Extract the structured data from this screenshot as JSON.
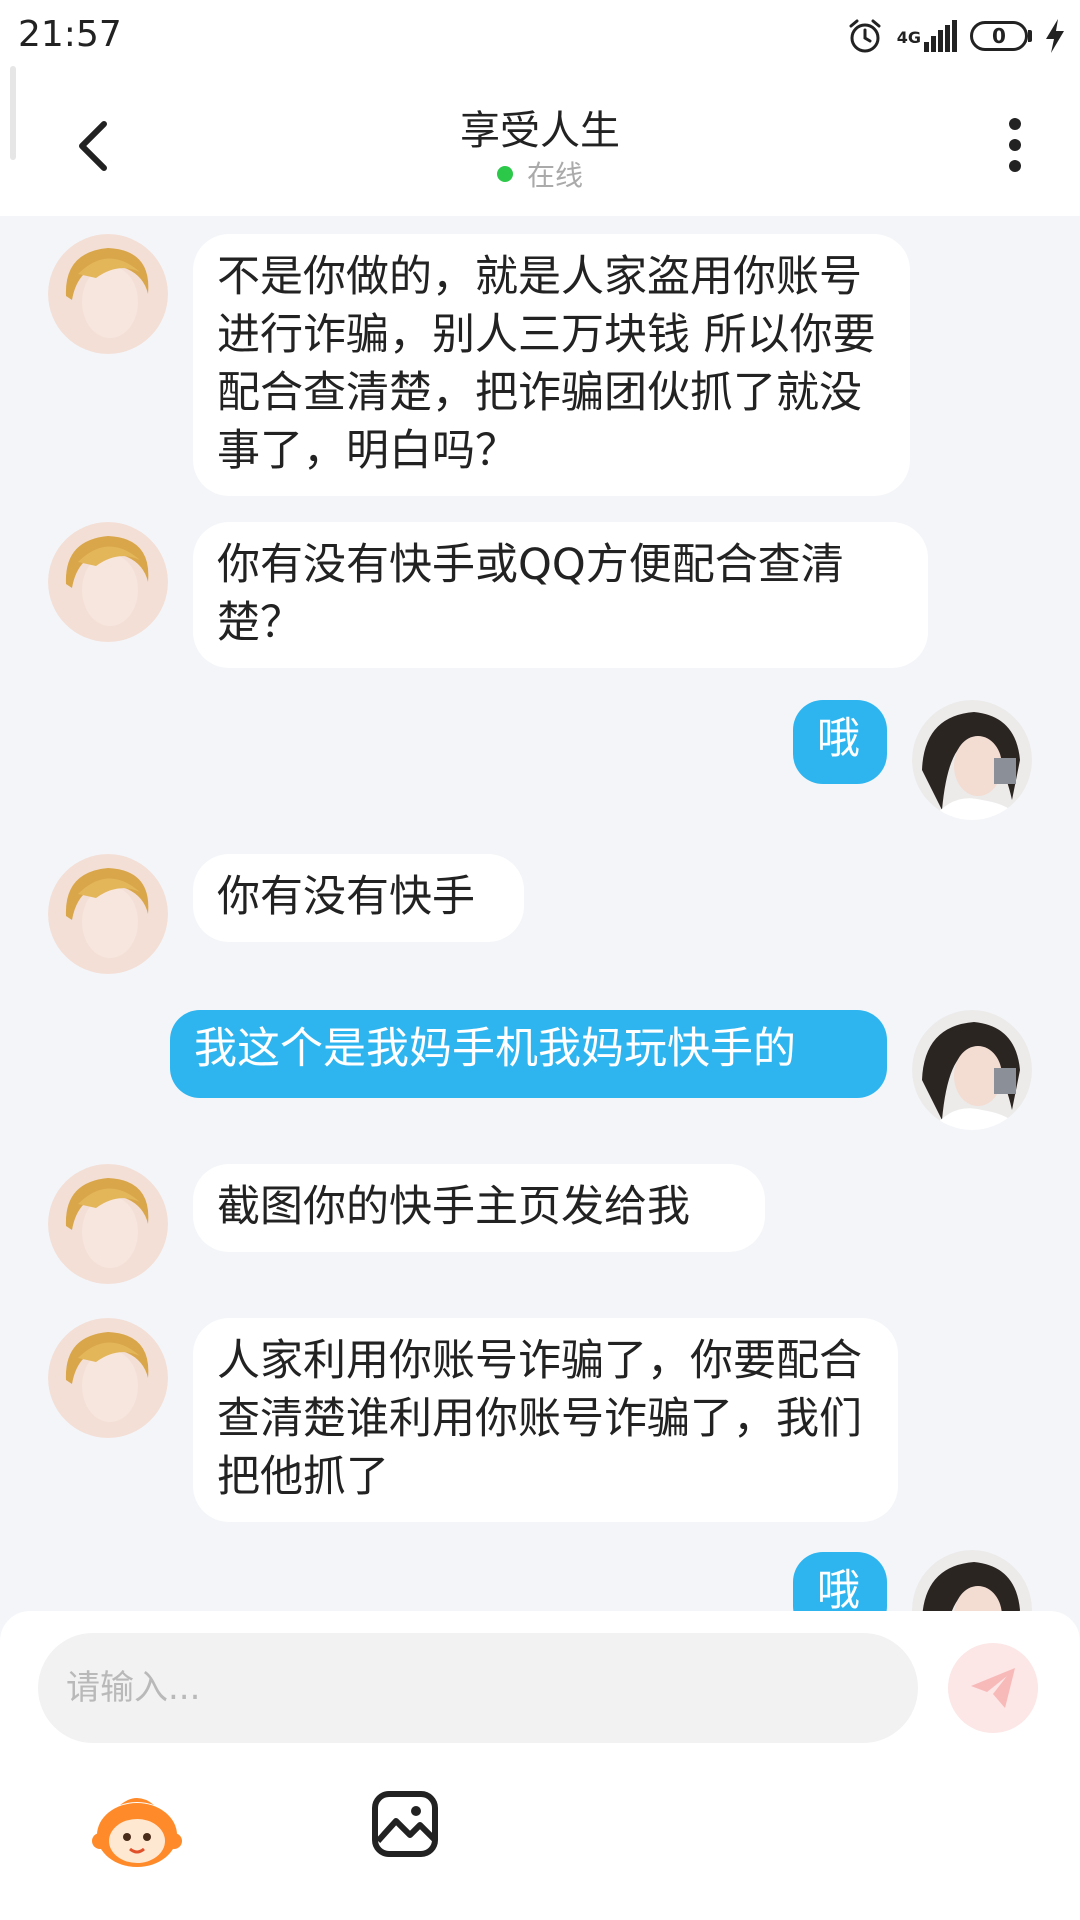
{
  "status_bar": {
    "time": "21:57",
    "network": "4G",
    "battery": "0"
  },
  "header": {
    "title": "享受人生",
    "status": "在线"
  },
  "messages": [
    {
      "side": "in",
      "text": "不是你做的，就是人家盗用你账号进行诈骗，别人三万块钱 所以你要配合查清楚，把诈骗团伙抓了就没事了，明白吗？"
    },
    {
      "side": "in",
      "text": "你有没有快手或QQ方便配合查清楚？"
    },
    {
      "side": "out",
      "text": "哦"
    },
    {
      "side": "in",
      "text": "你有没有快手"
    },
    {
      "side": "out",
      "text": "我这个是我妈手机我妈玩快手的"
    },
    {
      "side": "in",
      "text": "截图你的快手主页发给我"
    },
    {
      "side": "in",
      "text": "人家利用你账号诈骗了，你要配合查清楚谁利用你账号诈骗了，我们把他抓了"
    },
    {
      "side": "out",
      "text": "哦"
    }
  ],
  "composer": {
    "placeholder": "请输入..."
  },
  "colors": {
    "outgoing_bubble": "#2eb5f0",
    "incoming_bubble": "#ffffff",
    "online_dot": "#2cc84a",
    "send_button": "#fce6e6"
  },
  "icons": [
    "back-arrow-icon",
    "more-vertical-icon",
    "alarm-icon",
    "signal-icon",
    "battery-icon",
    "charging-icon",
    "send-icon",
    "emoji-mascot-icon",
    "image-icon"
  ]
}
